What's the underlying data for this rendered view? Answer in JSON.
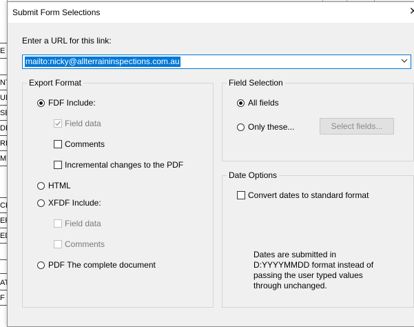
{
  "dialog": {
    "title": "Submit Form Selections",
    "url_label": "Enter a URL for this link:",
    "url_value": "mailto:nicky@allterraininspections.com.au"
  },
  "export_format": {
    "legend": "Export Format",
    "fdf": {
      "label": "FDF  Include:",
      "selected": true
    },
    "fdf_options": [
      {
        "label": "Field data",
        "checked": true,
        "disabled": true
      },
      {
        "label": "Comments",
        "checked": false,
        "disabled": false
      },
      {
        "label": "Incremental changes to the PDF",
        "checked": false,
        "disabled": false
      }
    ],
    "html": {
      "label": "HTML",
      "selected": false
    },
    "xfdf": {
      "label": "XFDF  Include:",
      "selected": false
    },
    "xfdf_options": [
      {
        "label": "Field data",
        "checked": false,
        "disabled": true
      },
      {
        "label": "Comments",
        "checked": false,
        "disabled": true
      }
    ],
    "pdf": {
      "label": "PDF  The complete document",
      "selected": false
    }
  },
  "field_selection": {
    "legend": "Field Selection",
    "all_fields": {
      "label": "All fields",
      "selected": true
    },
    "only_these": {
      "label": "Only these...",
      "selected": false
    },
    "select_button": "Select fields..."
  },
  "date_options": {
    "legend": "Date Options",
    "convert": {
      "label": "Convert dates to standard format",
      "checked": false
    },
    "note": [
      "Dates are submitted in",
      "D:YYYYMMDD format instead of",
      "passing the user typed values",
      "through unchanged."
    ]
  },
  "background_fragments": [
    "E",
    "NT",
    "UN",
    "SE",
    "DE",
    "RE",
    "ME",
    "CH",
    "ER",
    "ED",
    "AT",
    "F"
  ],
  "colors": {
    "accent": "#0078d7",
    "dialog_bg": "#f0f0f0",
    "disabled_text": "#7a7a7a"
  }
}
